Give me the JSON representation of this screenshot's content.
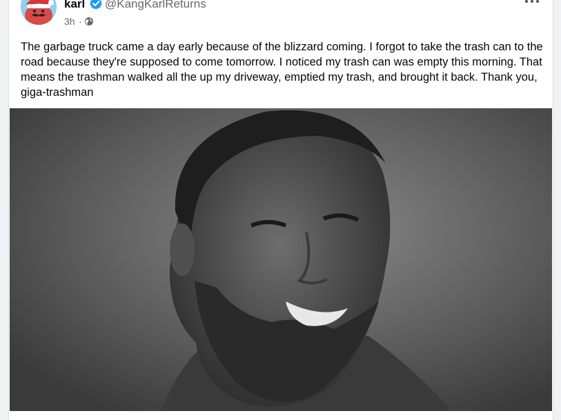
{
  "post": {
    "author_name": "karl",
    "author_handle": "@KangKarlReturns",
    "time": "3h",
    "separator": "·",
    "body": "The garbage truck came a day early because of the blizzard coming. I forgot to take the trash can to the road because they're supposed to come tomorrow. I noticed my trash can was empty this morning. That means the trashman walked all the up my driveway, emptied my trash, and brought it back. Thank you, giga-trashman",
    "verified_icon": "verified-badge-icon",
    "audience_icon": "globe-icon",
    "more_icon": "more-options-icon"
  },
  "colors": {
    "verified": "#1d9bf0",
    "secondary_text": "#65676b",
    "photo_bg": "#5a5a5a"
  }
}
